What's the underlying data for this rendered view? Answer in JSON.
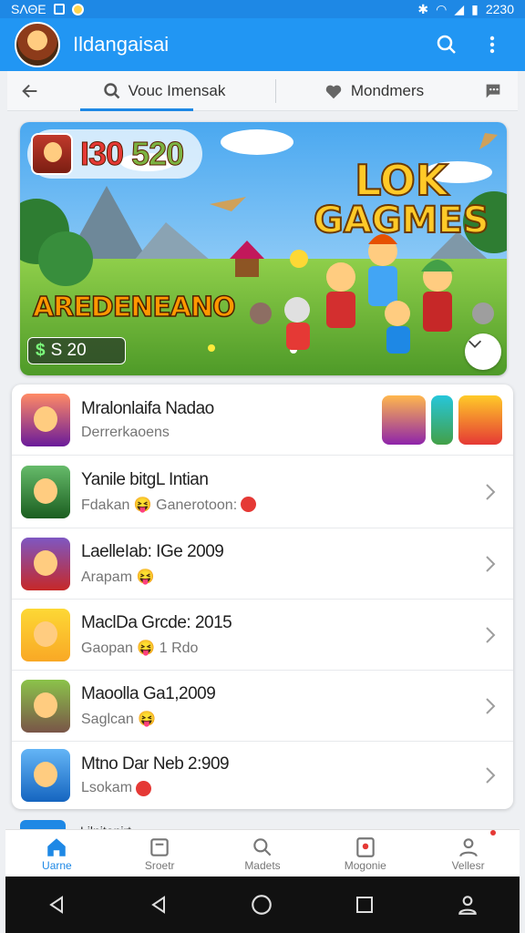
{
  "status_bar": {
    "left_text": "SΛΘΕ",
    "time": "2230",
    "icons": [
      "bluetooth-icon",
      "mute-icon",
      "wifi-icon",
      "signal-icon",
      "battery-icon"
    ]
  },
  "app_bar": {
    "title": "Ildangaisai",
    "icons": [
      "search-icon",
      "more-vert-icon"
    ]
  },
  "tabs": [
    {
      "label": "Vouc Imensak",
      "icon": "search-icon",
      "active": true
    },
    {
      "label": "Mondmers",
      "icon": "heart-icon",
      "active": false
    }
  ],
  "banner": {
    "score_left": "I30",
    "score_right": "520",
    "logo_line1": "LOK",
    "logo_line2": "GAGMES",
    "name": "AREDENEANO",
    "coins": "S 20",
    "coin_symbol": "$"
  },
  "list": [
    {
      "title": "Mralonlaifa Nadao",
      "subtitle": "Derrerkaoens",
      "has_mini_icons": true
    },
    {
      "title": "Yanile bitgL Intian",
      "subtitle": "Fdakan 😝 Ganerotoon:",
      "emoji": "red"
    },
    {
      "title": "LaelleIab: IGe 2009",
      "subtitle": "Arapam 😝"
    },
    {
      "title": "MaclDa Grcde: 2015",
      "subtitle": "Gaopan 😝 1 Rdo"
    },
    {
      "title": "Maoolla Ga1,2009",
      "subtitle": "Saglcan 😝"
    },
    {
      "title": "Mtno Dar Neb 2:909",
      "subtitle": "Lsokam",
      "emoji": "red"
    }
  ],
  "peek_text": "Lilnitonirt...",
  "bottom_nav": [
    {
      "label": "Uarne",
      "icon": "home-icon",
      "active": true
    },
    {
      "label": "Sroetr",
      "icon": "store-icon",
      "active": false
    },
    {
      "label": "Madets",
      "icon": "search-icon",
      "active": false
    },
    {
      "label": "Mogonie",
      "icon": "badge-icon",
      "active": false
    },
    {
      "label": "Vellesr",
      "icon": "person-icon",
      "active": false,
      "dot": true
    }
  ],
  "colors": {
    "primary": "#2196f3",
    "accent_red": "#e53935",
    "status": "#1e88e5"
  }
}
